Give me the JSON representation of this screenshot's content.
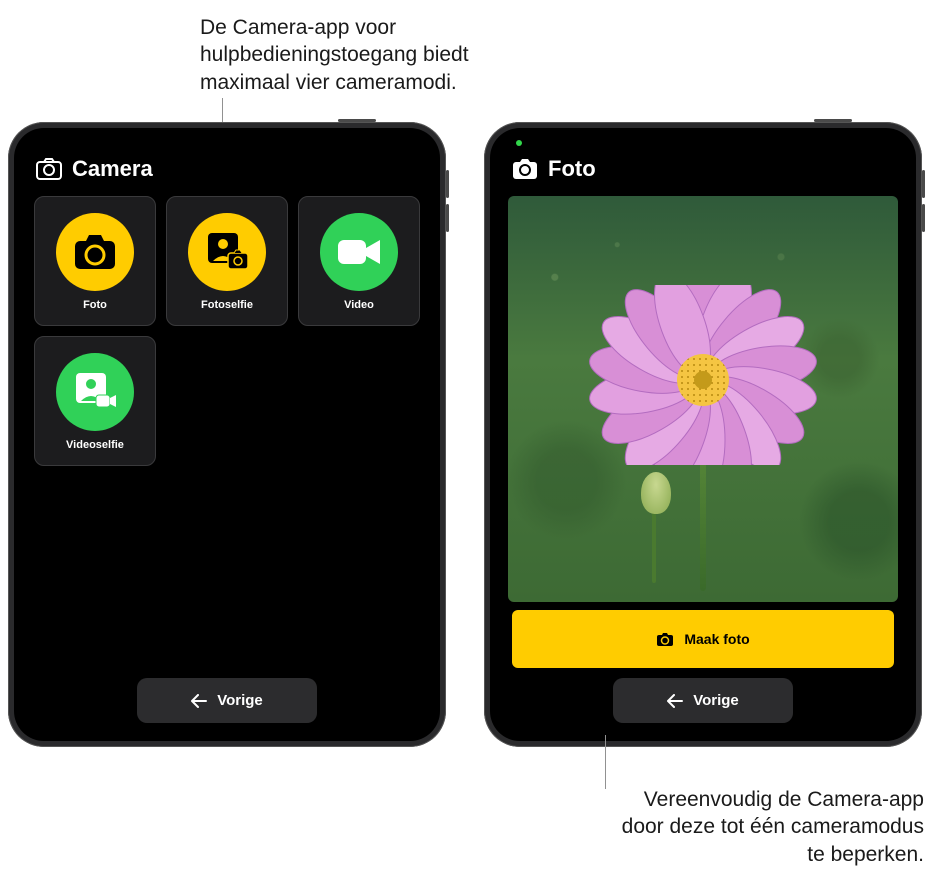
{
  "annotations": {
    "top": "De Camera-app voor hulpbedieningstoegang biedt maximaal vier cameramodi.",
    "bottom": "Vereenvoudig de Camera-app door deze tot één cameramodus te beperken."
  },
  "left_ipad": {
    "header_title": "Camera",
    "modes": [
      {
        "label": "Foto",
        "color": "yellow",
        "icon": "camera"
      },
      {
        "label": "Fotoselfie",
        "color": "yellow",
        "icon": "selfie-photo"
      },
      {
        "label": "Video",
        "color": "green",
        "icon": "video"
      },
      {
        "label": "Videoselfie",
        "color": "green",
        "icon": "selfie-video"
      }
    ],
    "back_label": "Vorige"
  },
  "right_ipad": {
    "header_title": "Foto",
    "capture_label": "Maak foto",
    "back_label": "Vorige"
  }
}
